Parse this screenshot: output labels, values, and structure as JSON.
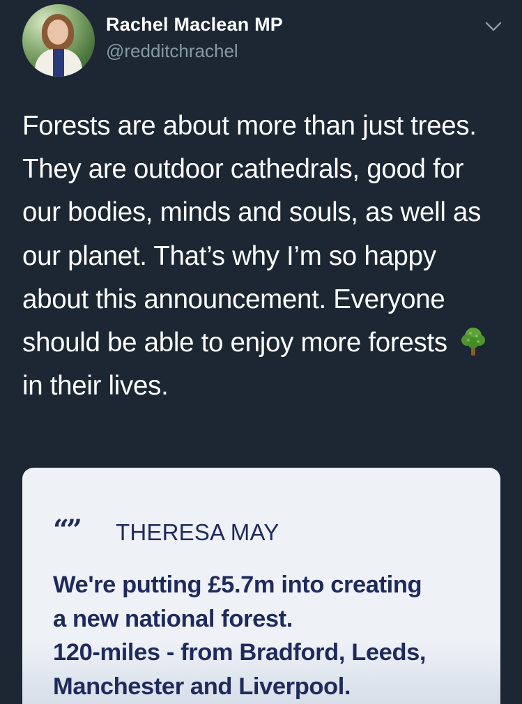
{
  "tweet": {
    "author_name": "Rachel Maclean MP",
    "author_handle": "@redditchrachel",
    "text_before_emoji": "Forests are about more than just trees. They are outdoor cathedrals, good for our bodies, minds and souls, as well as our planet. That’s why I’m so happy about this announcement. Everyone should be able to enjoy more forests",
    "emoji_icon": "deciduous-tree-icon",
    "text_after_emoji": "in their lives."
  },
  "card": {
    "quote_mark": "“”",
    "quote_author": "THERESA MAY",
    "quote_lines": [
      "We're putting £5.7m into creating",
      "a new national forest.",
      "120-miles - from Bradford, Leeds,",
      "Manchester and Liverpool."
    ]
  },
  "colors": {
    "background": "#1c2733",
    "name": "#ffffff",
    "handle": "#8899a6",
    "card_background": "#eef1f6",
    "quote_text": "#1f2a5c"
  },
  "icons": {
    "menu_chevron": "chevron-down-icon",
    "avatar": "profile-photo"
  }
}
